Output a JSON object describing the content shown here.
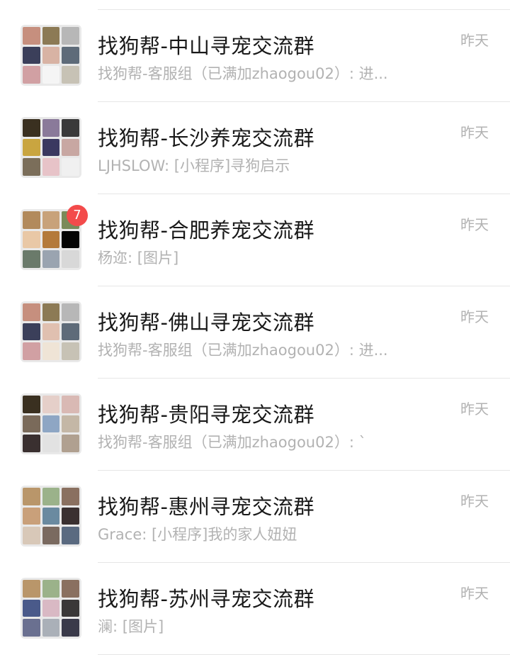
{
  "chats": [
    {
      "title": "找狗帮-中山寻宠交流群",
      "preview": "找狗帮-客服组（已满加zhaogou02）: 进...",
      "time": "昨天",
      "badge": "",
      "avatar_colors": [
        "#c68f7e",
        "#8c7a55",
        "#b7b7b7",
        "#3b3f5a",
        "#d8b3a4",
        "#5e6b79",
        "#d1a0a3",
        "#f5f5f5",
        "#c7c2b5"
      ]
    },
    {
      "title": "找狗帮-长沙养宠交流群",
      "preview": "LJHSLOW: [小程序]寻狗启示",
      "time": "昨天",
      "badge": "",
      "avatar_colors": [
        "#3a3020",
        "#8a7a9a",
        "#3a3a3a",
        "#c9a540",
        "#3a3860",
        "#c8a7a2",
        "#7b6e5a",
        "#e7c3c8",
        "#f0f0f0"
      ]
    },
    {
      "title": "找狗帮-合肥养宠交流群",
      "preview": "杨迩: [图片]",
      "time": "昨天",
      "badge": "7",
      "avatar_colors": [
        "#b28a5c",
        "#c8a27a",
        "#7a8a5a",
        "#e9c8a6",
        "#b47a3a",
        "#050505",
        "#6a7a6a",
        "#9aa4b0",
        "#d8d8d8"
      ]
    },
    {
      "title": "找狗帮-佛山寻宠交流群",
      "preview": "找狗帮-客服组（已满加zhaogou02）: 进...",
      "time": "昨天",
      "badge": "",
      "avatar_colors": [
        "#c68f7e",
        "#8c7a55",
        "#b7b7b7",
        "#3b3f5a",
        "#e0c0b0",
        "#5e6b79",
        "#d1a0a3",
        "#efe4d6",
        "#c7c2b5"
      ]
    },
    {
      "title": "找狗帮-贵阳寻宠交流群",
      "preview": "找狗帮-客服组（已满加zhaogou02）: `",
      "time": "昨天",
      "badge": "",
      "avatar_colors": [
        "#3a3020",
        "#e5cfc9",
        "#d9b9b4",
        "#7a6a5a",
        "#8ea6c4",
        "#c4b7a6",
        "#3a3030",
        "#e2e2e2",
        "#b0a090"
      ]
    },
    {
      "title": "找狗帮-惠州寻宠交流群",
      "preview": "Grace: [小程序]我的家人妞妞",
      "time": "昨天",
      "badge": "",
      "avatar_colors": [
        "#b9966a",
        "#9bb28a",
        "#8a7060",
        "#c9a07a",
        "#6a8aa0",
        "#3a3030",
        "#d8c8b8",
        "#7a6a60",
        "#5a6a80"
      ]
    },
    {
      "title": "找狗帮-苏州寻宠交流群",
      "preview": "澜: [图片]",
      "time": "昨天",
      "badge": "",
      "avatar_colors": [
        "#b9966a",
        "#9bb28a",
        "#8a7060",
        "#4a5a8a",
        "#d9b9c4",
        "#3a3838",
        "#6a7090",
        "#aab0b8",
        "#3a3a4a"
      ]
    }
  ]
}
